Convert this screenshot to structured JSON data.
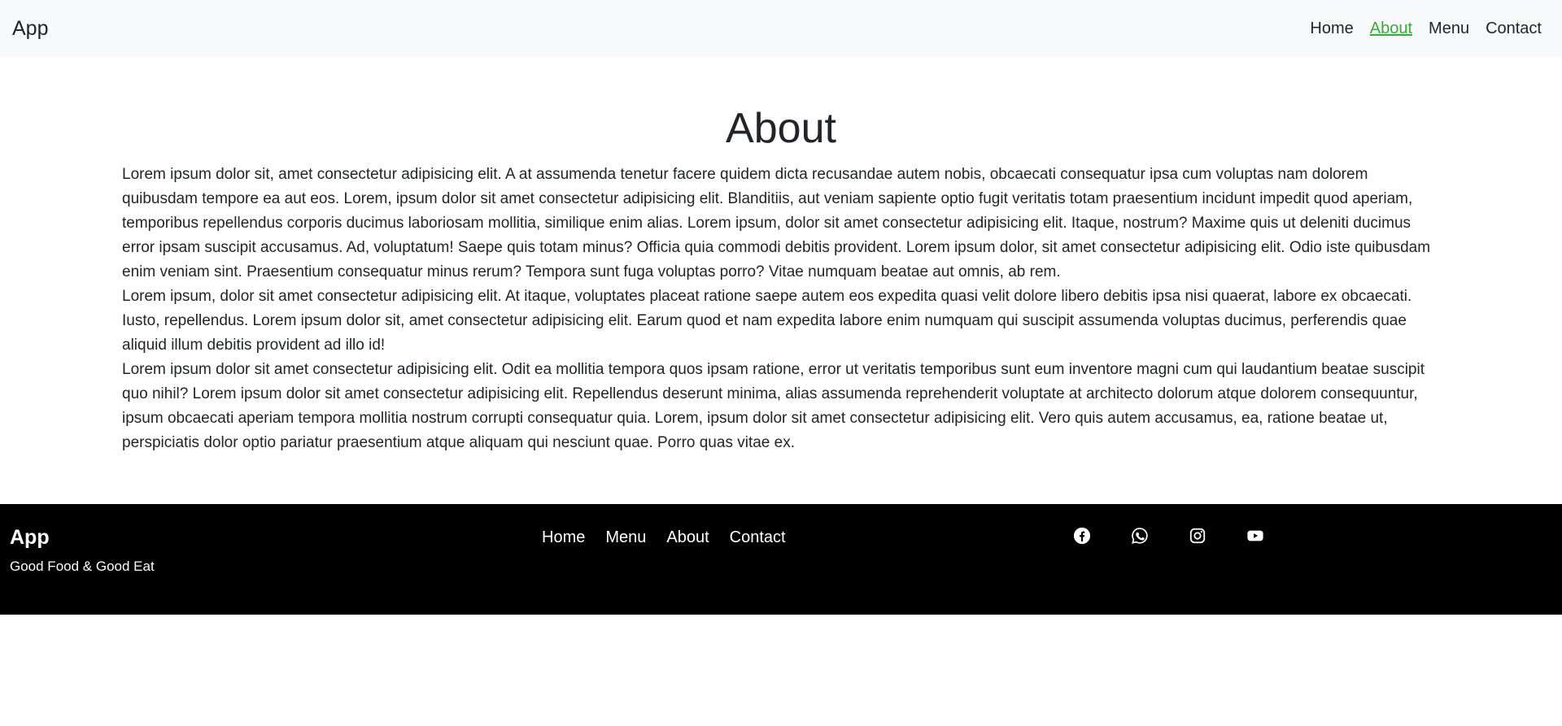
{
  "header": {
    "brand": "App",
    "nav": [
      "Home",
      "About",
      "Menu",
      "Contact"
    ],
    "active": "About",
    "active_color": "#3aa83a"
  },
  "main": {
    "title": "About",
    "paragraphs": [
      "Lorem ipsum dolor sit, amet consectetur adipisicing elit. A at assumenda tenetur facere quidem dicta recusandae autem nobis, obcaecati consequatur ipsa cum voluptas nam dolorem quibusdam tempore ea aut eos. Lorem, ipsum dolor sit amet consectetur adipisicing elit. Blanditiis, aut veniam sapiente optio fugit veritatis totam praesentium incidunt impedit quod aperiam, temporibus repellendus corporis ducimus laboriosam mollitia, similique enim alias. Lorem ipsum, dolor sit amet consectetur adipisicing elit. Itaque, nostrum? Maxime quis ut deleniti ducimus error ipsam suscipit accusamus. Ad, voluptatum! Saepe quis totam minus? Officia quia commodi debitis provident. Lorem ipsum dolor, sit amet consectetur adipisicing elit. Odio iste quibusdam enim veniam sint. Praesentium consequatur minus rerum? Tempora sunt fuga voluptas porro? Vitae numquam beatae aut omnis, ab rem.",
      "Lorem ipsum, dolor sit amet consectetur adipisicing elit. At itaque, voluptates placeat ratione saepe autem eos expedita quasi velit dolore libero debitis ipsa nisi quaerat, labore ex obcaecati. Iusto, repellendus. Lorem ipsum dolor sit, amet consectetur adipisicing elit. Earum quod et nam expedita labore enim numquam qui suscipit assumenda voluptas ducimus, perferendis quae aliquid illum debitis provident ad illo id!",
      "Lorem ipsum dolor sit amet consectetur adipisicing elit. Odit ea mollitia tempora quos ipsam ratione, error ut veritatis temporibus sunt eum inventore magni cum qui laudantium beatae suscipit quo nihil? Lorem ipsum dolor sit amet consectetur adipisicing elit. Repellendus deserunt minima, alias assumenda reprehenderit voluptate at architecto dolorum atque dolorem consequuntur, ipsum obcaecati aperiam tempora mollitia nostrum corrupti consequatur quia. Lorem, ipsum dolor sit amet consectetur adipisicing elit. Vero quis autem accusamus, ea, ratione beatae ut, perspiciatis dolor optio pariatur praesentium atque aliquam qui nesciunt quae. Porro quas vitae ex."
    ]
  },
  "footer": {
    "brand": "App",
    "tagline": "Good Food & Good Eat",
    "nav": [
      "Home",
      "Menu",
      "About",
      "Contact"
    ],
    "socials": [
      "facebook-icon",
      "whatsapp-icon",
      "instagram-icon",
      "youtube-icon"
    ]
  }
}
